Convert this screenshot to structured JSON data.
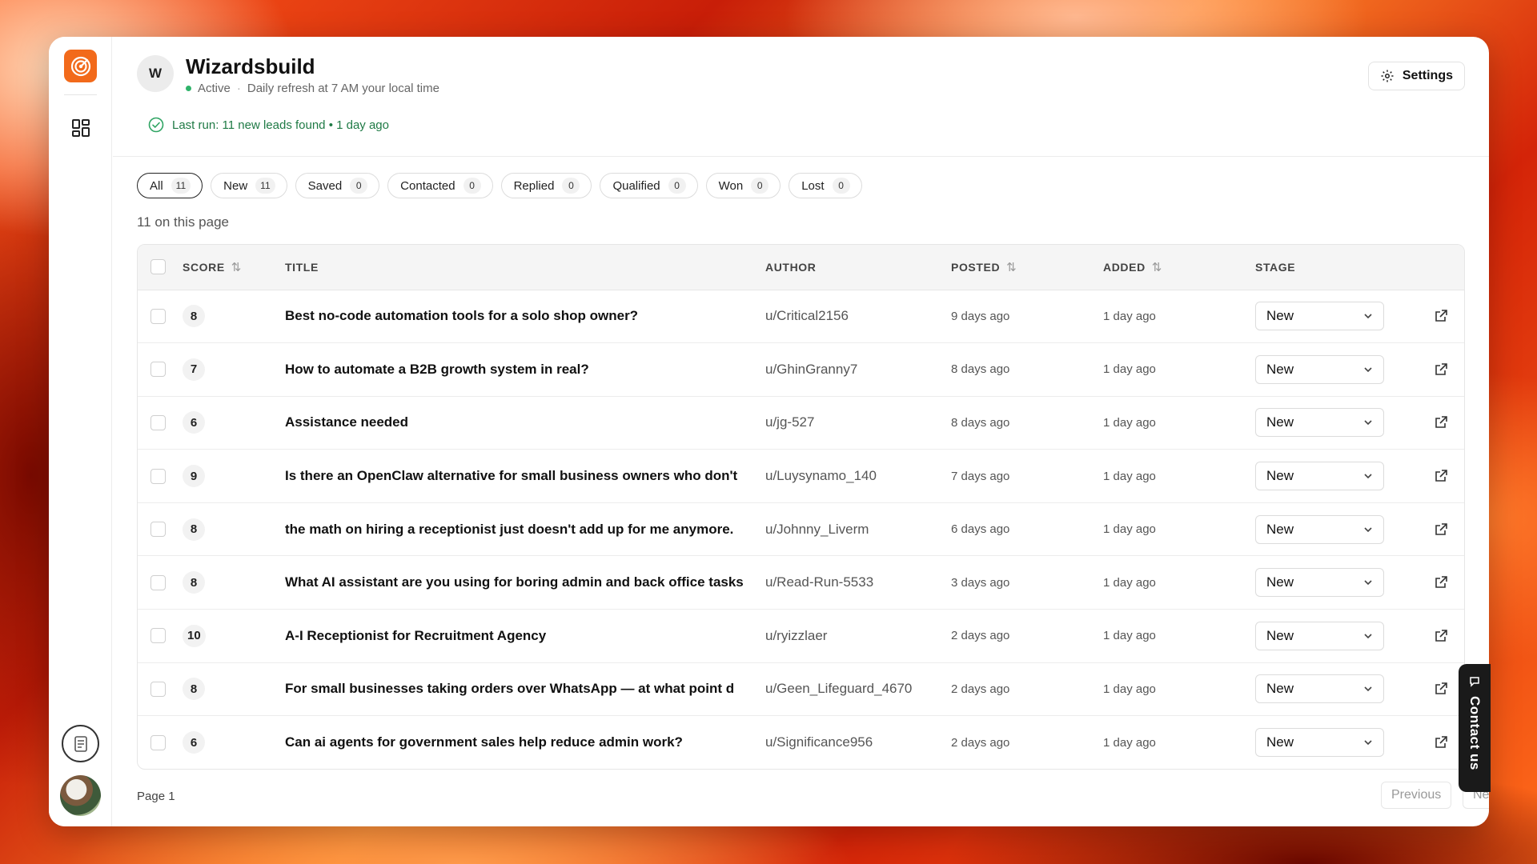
{
  "project": {
    "avatar_letter": "W",
    "name": "Wizardsbuild",
    "status": "Active",
    "schedule": "Daily refresh at 7 AM your local time",
    "last_run": "Last run: 11 new leads found • 1 day ago"
  },
  "toolbar": {
    "settings_label": "Settings"
  },
  "filters": [
    {
      "label": "All",
      "count": "11"
    },
    {
      "label": "New",
      "count": "11"
    },
    {
      "label": "Saved",
      "count": "0"
    },
    {
      "label": "Contacted",
      "count": "0"
    },
    {
      "label": "Replied",
      "count": "0"
    },
    {
      "label": "Qualified",
      "count": "0"
    },
    {
      "label": "Won",
      "count": "0"
    },
    {
      "label": "Lost",
      "count": "0"
    }
  ],
  "page_count_text": "11 on this page",
  "table": {
    "columns": {
      "score": "SCORE",
      "title": "TITLE",
      "author": "AUTHOR",
      "posted": "POSTED",
      "added": "ADDED",
      "stage": "STAGE"
    },
    "rows": [
      {
        "score": "8",
        "title": "Best no-code automation tools for a solo shop owner?",
        "author": "u/Critical2156",
        "posted": "9 days ago",
        "added": "1 day ago",
        "stage": "New"
      },
      {
        "score": "7",
        "title": "How to automate a B2B growth system in real?",
        "author": "u/GhinGranny7",
        "posted": "8 days ago",
        "added": "1 day ago",
        "stage": "New"
      },
      {
        "score": "6",
        "title": "Assistance needed",
        "author": "u/jg-527",
        "posted": "8 days ago",
        "added": "1 day ago",
        "stage": "New"
      },
      {
        "score": "9",
        "title": "Is there an OpenClaw alternative for small business owners who don't",
        "author": "u/Luysynamo_140",
        "posted": "7 days ago",
        "added": "1 day ago",
        "stage": "New"
      },
      {
        "score": "8",
        "title": "the math on hiring a receptionist just doesn't add up for me anymore.",
        "author": "u/Johnny_Liverm",
        "posted": "6 days ago",
        "added": "1 day ago",
        "stage": "New"
      },
      {
        "score": "8",
        "title": "What AI assistant are you using for boring admin and back office tasks",
        "author": "u/Read-Run-5533",
        "posted": "3 days ago",
        "added": "1 day ago",
        "stage": "New"
      },
      {
        "score": "10",
        "title": "A-I Receptionist for Recruitment Agency",
        "author": "u/ryizzlaer",
        "posted": "2 days ago",
        "added": "1 day ago",
        "stage": "New"
      },
      {
        "score": "8",
        "title": "For small businesses taking orders over WhatsApp — at what point d",
        "author": "u/Geen_Lifeguard_4670",
        "posted": "2 days ago",
        "added": "1 day ago",
        "stage": "New"
      },
      {
        "score": "6",
        "title": "Can ai agents for government sales help reduce admin work?",
        "author": "u/Significance956",
        "posted": "2 days ago",
        "added": "1 day ago",
        "stage": "New"
      }
    ]
  },
  "pagination": {
    "page_label": "Page 1",
    "previous": "Previous",
    "next": "Next"
  },
  "contact_tab_label": "Contact us",
  "colors": {
    "brand": "#f26a1b",
    "status_active": "#2fb36a",
    "last_run_text": "#1f7a45"
  },
  "icons": [
    "logo-icon",
    "dashboard-grid-icon",
    "document-icon",
    "settings-gear-icon",
    "check-circle-icon",
    "sort-icon",
    "chevron-down-icon",
    "external-link-icon",
    "chat-icon"
  ]
}
